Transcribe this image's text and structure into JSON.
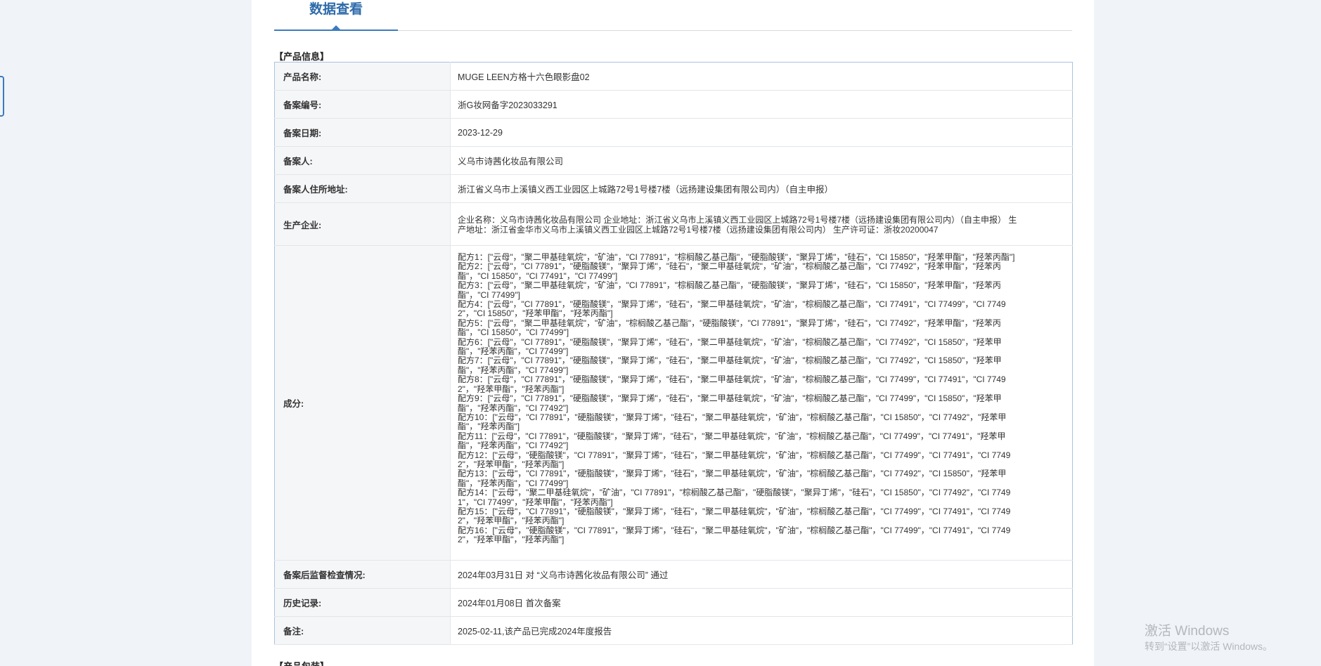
{
  "tab": {
    "label": "数据查看"
  },
  "sections": {
    "product_info": "【产品信息】",
    "product_pack": "【产品包装】"
  },
  "rows": {
    "name": {
      "label": "产品名称:",
      "value": "MUGE LEEN方格十六色眼影盘02"
    },
    "record_no": {
      "label": "备案编号:",
      "value": "浙G妆网备字2023033291"
    },
    "record_date": {
      "label": "备案日期:",
      "value": "2023-12-29"
    },
    "registrant": {
      "label": "备案人:",
      "value": "义乌市诗茜化妆品有限公司"
    },
    "registrant_address": {
      "label": "备案人住所地址:",
      "value": "浙江省义乌市上溪镇义西工业园区上城路72号1号楼7楼（远扬建设集团有限公司内）（自主申报）"
    },
    "manufacturer": {
      "label": "生产企业:",
      "value": "企业名称：义乌市诗茜化妆品有限公司 企业地址：浙江省义乌市上溪镇义西工业园区上城路72号1号楼7楼（远扬建设集团有限公司内）（自主申报） 生产地址：浙江省金华市义乌市上溪镇义西工业园区上城路72号1号楼7楼（远扬建设集团有限公司内） 生产许可证：浙妆20200047"
    },
    "ingredients": {
      "label": "成分:",
      "formulas": [
        "配方1：[\"云母\"，\"聚二甲基硅氧烷\"，\"矿油\"，\"CI 77891\"，\"棕榈酸乙基己酯\"，\"硬脂酸镁\"，\"聚异丁烯\"，\"硅石\"，\"CI 15850\"，\"羟苯甲酯\"，\"羟苯丙酯\"]",
        "配方2：[\"云母\"，\"CI 77891\"，\"硬脂酸镁\"，\"聚异丁烯\"，\"硅石\"，\"聚二甲基硅氧烷\"，\"矿油\"，\"棕榈酸乙基己酯\"，\"CI 77492\"，\"羟苯甲酯\"，\"羟苯丙酯\"，\"CI 15850\"，\"CI 77491\"，\"CI 77499\"]",
        "配方3：[\"云母\"，\"聚二甲基硅氧烷\"，\"矿油\"，\"CI 77891\"，\"棕榈酸乙基己酯\"，\"硬脂酸镁\"，\"聚异丁烯\"，\"硅石\"，\"CI 15850\"，\"羟苯甲酯\"，\"羟苯丙酯\"，\"CI 77499\"]",
        "配方4：[\"云母\"，\"CI 77891\"，\"硬脂酸镁\"，\"聚异丁烯\"，\"硅石\"，\"聚二甲基硅氧烷\"，\"矿油\"，\"棕榈酸乙基己酯\"，\"CI 77491\"，\"CI 77499\"，\"CI 77492\"，\"CI 15850\"，\"羟苯甲酯\"，\"羟苯丙酯\"]",
        "配方5：[\"云母\"，\"聚二甲基硅氧烷\"，\"矿油\"，\"棕榈酸乙基己酯\"，\"硬脂酸镁\"，\"CI 77891\"，\"聚异丁烯\"，\"硅石\"，\"CI 77492\"，\"羟苯甲酯\"，\"羟苯丙酯\"，\"CI 15850\"，\"CI 77499\"]",
        "配方6：[\"云母\"，\"CI 77891\"，\"硬脂酸镁\"，\"聚异丁烯\"，\"硅石\"，\"聚二甲基硅氧烷\"，\"矿油\"，\"棕榈酸乙基己酯\"，\"CI 77492\"，\"CI 15850\"，\"羟苯甲酯\"，\"羟苯丙酯\"，\"CI 77499\"]",
        "配方7：[\"云母\"，\"CI 77891\"，\"硬脂酸镁\"，\"聚异丁烯\"，\"硅石\"，\"聚二甲基硅氧烷\"，\"矿油\"，\"棕榈酸乙基己酯\"，\"CI 77492\"，\"CI 15850\"，\"羟苯甲酯\"，\"羟苯丙酯\"，\"CI 77499\"]",
        "配方8：[\"云母\"，\"CI 77891\"，\"硬脂酸镁\"，\"聚异丁烯\"，\"硅石\"，\"聚二甲基硅氧烷\"，\"矿油\"，\"棕榈酸乙基己酯\"，\"CI 77499\"，\"CI 77491\"，\"CI 77492\"，\"羟苯甲酯\"，\"羟苯丙酯\"]",
        "配方9：[\"云母\"，\"CI 77891\"，\"硬脂酸镁\"，\"聚异丁烯\"，\"硅石\"，\"聚二甲基硅氧烷\"，\"矿油\"，\"棕榈酸乙基己酯\"，\"CI 77499\"，\"CI 15850\"，\"羟苯甲酯\"，\"羟苯丙酯\"，\"CI 77492\"]",
        "配方10：[\"云母\"，\"CI 77891\"，\"硬脂酸镁\"，\"聚异丁烯\"，\"硅石\"，\"聚二甲基硅氧烷\"，\"矿油\"，\"棕榈酸乙基己酯\"，\"CI 15850\"，\"CI 77492\"，\"羟苯甲酯\"，\"羟苯丙酯\"]",
        "配方11：[\"云母\"，\"CI 77891\"，\"硬脂酸镁\"，\"聚异丁烯\"，\"硅石\"，\"聚二甲基硅氧烷\"，\"矿油\"，\"棕榈酸乙基己酯\"，\"CI 77499\"，\"CI 77491\"，\"羟苯甲酯\"，\"羟苯丙酯\"，\"CI 77492\"]",
        "配方12：[\"云母\"，\"硬脂酸镁\"，\"CI 77891\"，\"聚异丁烯\"，\"硅石\"，\"聚二甲基硅氧烷\"，\"矿油\"，\"棕榈酸乙基己酯\"，\"CI 77499\"，\"CI 77491\"，\"CI 77492\"，\"羟苯甲酯\"，\"羟苯丙酯\"]",
        "配方13：[\"云母\"，\"CI 77891\"，\"硬脂酸镁\"，\"聚异丁烯\"，\"硅石\"，\"聚二甲基硅氧烷\"，\"矿油\"，\"棕榈酸乙基己酯\"，\"CI 77492\"，\"CI 15850\"，\"羟苯甲酯\"，\"羟苯丙酯\"，\"CI 77499\"]",
        "配方14：[\"云母\"，\"聚二甲基硅氧烷\"，\"矿油\"，\"CI 77891\"，\"棕榈酸乙基己酯\"，\"硬脂酸镁\"，\"聚异丁烯\"，\"硅石\"，\"CI 15850\"，\"CI 77492\"，\"CI 77491\"，\"CI 77499\"，\"羟苯甲酯\"，\"羟苯丙酯\"]",
        "配方15：[\"云母\"，\"CI 77891\"，\"硬脂酸镁\"，\"聚异丁烯\"，\"硅石\"，\"聚二甲基硅氧烷\"，\"矿油\"，\"棕榈酸乙基己酯\"，\"CI 77499\"，\"CI 77491\"，\"CI 77492\"，\"羟苯甲酯\"，\"羟苯丙酯\"]",
        "配方16：[\"云母\"，\"硬脂酸镁\"，\"CI 77891\"，\"聚异丁烯\"，\"硅石\"，\"聚二甲基硅氧烷\"，\"矿油\"，\"棕榈酸乙基己酯\"，\"CI 77499\"，\"CI 77491\"，\"CI 77492\"，\"羟苯甲酯\"，\"羟苯丙酯\"]"
      ]
    },
    "inspection": {
      "label": "备案后监督检查情况:",
      "value": "2024年03月31日 对 “义乌市诗茜化妆品有限公司” 通过"
    },
    "history": {
      "label": "历史记录:",
      "value": "2024年01月08日 首次备案"
    },
    "remarks": {
      "label": "备注:",
      "value": "2025-02-11,该产品已完成2024年度报告"
    }
  },
  "watermark": {
    "title": "激活 Windows",
    "subtitle": "转到“设置”以激活 Windows。"
  },
  "colors": {
    "accent": "#3a7bbf",
    "tab_text": "#2d6aa9",
    "table_border": "#a9c4de",
    "label_bg": "#f5f6f8",
    "page_bg": "#f0f3f7"
  }
}
